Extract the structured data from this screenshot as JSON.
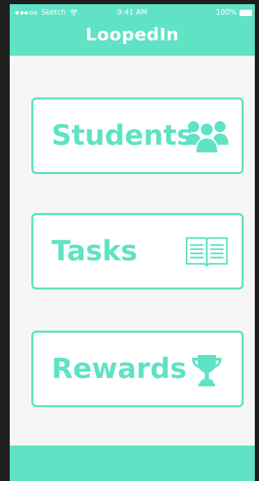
{
  "status_bar": {
    "carrier": "Sketch",
    "time": "9:41 AM",
    "battery": "100%"
  },
  "header": {
    "title": "LoopedIn"
  },
  "menu": {
    "items": [
      {
        "label": "Students",
        "icon": "group-icon"
      },
      {
        "label": "Tasks",
        "icon": "open-book-icon"
      },
      {
        "label": "Rewards",
        "icon": "trophy-icon"
      }
    ]
  },
  "colors": {
    "accent": "#5fe3c4",
    "background": "#f6f6f6",
    "text_on_accent": "#ffffff"
  }
}
